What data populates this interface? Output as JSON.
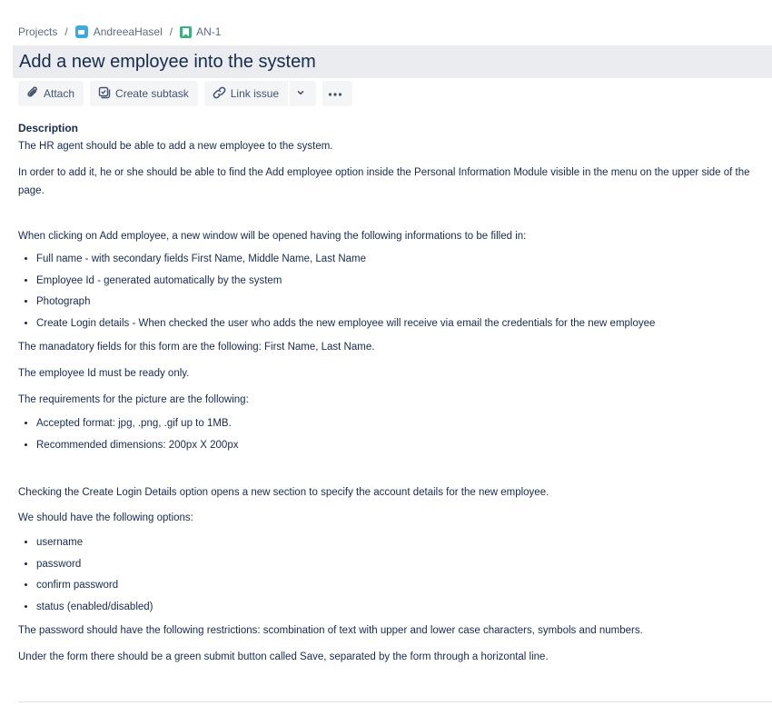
{
  "breadcrumb": {
    "projects": "Projects",
    "separator": "/",
    "project": "AndreeaHasel",
    "issue_key": "AN-1"
  },
  "issue": {
    "title": "Add a new employee into the system"
  },
  "toolbar": {
    "attach": "Attach",
    "create_subtask": "Create subtask",
    "link_issue": "Link issue"
  },
  "icons": {
    "attach": "paperclip-icon",
    "subtask": "subtask-icon",
    "link": "link-icon",
    "dropdown": "chevron-down-icon",
    "more": "more-icon",
    "project": "project-avatar-icon",
    "issue_type": "story-icon"
  },
  "colors": {
    "title_band": "#ebecf0",
    "button_bg": "#f4f5f7",
    "project_icon": "#3fa9de",
    "story_icon": "#36b37e"
  },
  "description": {
    "label": "Description",
    "p1": "The HR agent should be able to add a new employee to the system.",
    "p2": "In order to add it, he or she should be able to find the Add employee option inside the Personal Information Module visible in the menu on the upper side of the page.",
    "p3": "When clicking on Add employee, a new window will be opened having the following informations to be filled in:",
    "list1": [
      "Full name - with secondary fields First Name, Middle Name, Last Name",
      "Employee Id - generated automatically by the system",
      "Photograph",
      "Create Login details - When checked the user who adds the new employee will receive via email the credentials for the new employee"
    ],
    "p4": "The manadatory fields for this form are the following: First Name, Last Name.",
    "p5": "The employee Id must be ready only.",
    "p6": "The requirements for the picture are the following:",
    "list2": [
      "Accepted format:  jpg, .png, .gif up to 1MB.",
      "Recommended dimensions: 200px X 200px"
    ],
    "p7": "Checking the Create Login Details option opens a new section to specify the account details for the new employee.",
    "p8": "We should have the following options:",
    "list3": [
      "username",
      "password",
      "confirm password",
      "status (enabled/disabled)"
    ],
    "p9": "The password should have the following restrictions: scombination of text with upper and lower case characters, symbols and numbers.",
    "p10": "Under the form there should be a green submit button called Save, separated by the form through a horizontal line."
  }
}
